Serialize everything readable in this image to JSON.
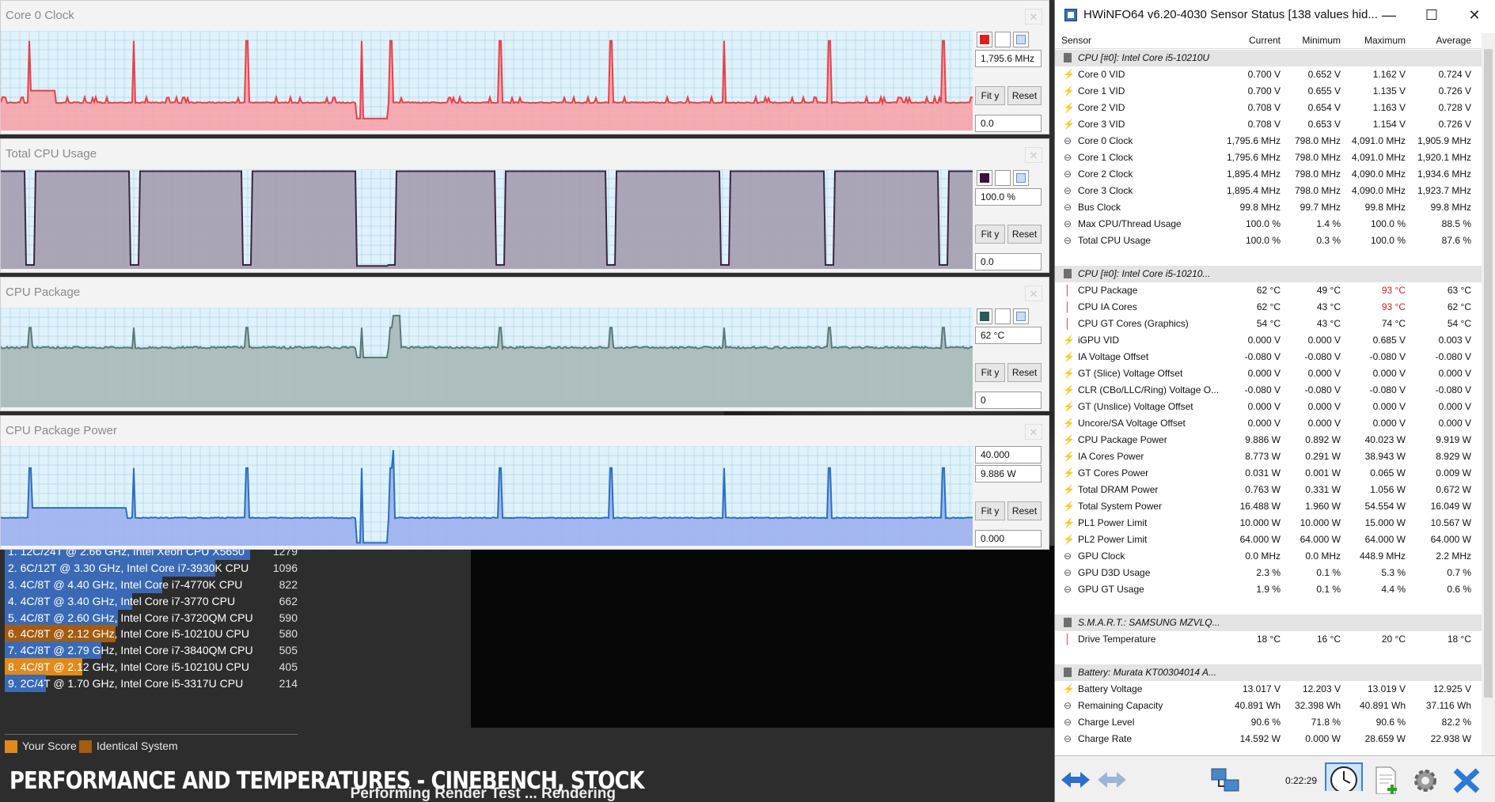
{
  "cinebench": {
    "ranking": [
      {
        "label": "1. 12C/24T @ 2.66 GHz, Intel Xeon CPU X5650",
        "score": "1279",
        "color": "#3a6ab5",
        "fraction": 1.0
      },
      {
        "label": "2. 6C/12T @ 3.30 GHz,  Intel Core i7-3930K CPU",
        "score": "1096",
        "color": "#3a6ab5",
        "fraction": 0.857
      },
      {
        "label": "3. 4C/8T @ 4.40 GHz, Intel Core i7-4770K CPU",
        "score": "822",
        "color": "#3a6ab5",
        "fraction": 0.643
      },
      {
        "label": "4. 4C/8T @ 3.40 GHz,  Intel Core i7-3770 CPU",
        "score": "662",
        "color": "#3a6ab5",
        "fraction": 0.518
      },
      {
        "label": "5. 4C/8T @ 2.60 GHz, Intel Core i7-3720QM CPU",
        "score": "590",
        "color": "#3a6ab5",
        "fraction": 0.461
      },
      {
        "label": "6. 4C/8T @ 2.12 GHz, Intel Core i5-10210U CPU",
        "score": "580",
        "color": "#a35c12",
        "fraction": 0.453
      },
      {
        "label": "7. 4C/8T @ 2.79 GHz, Intel Core i7-3840QM CPU",
        "score": "505",
        "color": "#3a6ab5",
        "fraction": 0.395
      },
      {
        "label": "8. 4C/8T @ 2.12 GHz, Intel Core i5-10210U CPU",
        "score": "405",
        "color": "#e08a1e",
        "fraction": 0.317
      },
      {
        "label": "9. 2C/4T @ 1.70 GHz,  Intel Core i5-3317U CPU",
        "score": "214",
        "color": "#3a6ab5",
        "fraction": 0.167
      }
    ],
    "legend": {
      "your_score": "Your Score",
      "identical_system": "Identical System",
      "your_color": "#e08a1e",
      "identical_color": "#a35c12"
    },
    "status": "Performing Render Test ... Rendering",
    "caption": "PERFORMANCE AND TEMPERATURES - CINEBENCH, STOCK"
  },
  "graphs": [
    {
      "title": "Core 0 Clock",
      "current": "1,795.6 MHz",
      "bottom": "0.0",
      "line_color": "#e8404a",
      "fill_color": "#f6a3a8",
      "swatch": "#e02020",
      "fit": "Fit y",
      "reset": "Reset"
    },
    {
      "title": "Total CPU Usage",
      "current": "100.0 %",
      "bottom": "0.0",
      "line_color": "#3d2440",
      "fill_color": "#a49db0",
      "swatch": "#3d1040",
      "fit": "Fit y",
      "reset": "Reset"
    },
    {
      "title": "CPU Package",
      "current": "62 °C",
      "bottom": "0",
      "line_color": "#5a7a78",
      "fill_color": "#a8b8b8",
      "swatch": "#2a5a5a",
      "fit": "Fit y",
      "reset": "Reset"
    },
    {
      "title": "CPU Package Power",
      "top": "40.000",
      "current": "9.886 W",
      "bottom": "0.000",
      "line_color": "#2a6fc2",
      "fill_color": "#9db0ee",
      "swatch": "#2a6fc2",
      "fit": "Fit y",
      "reset": "Reset"
    }
  ],
  "hwinfo": {
    "title": "HWiNFO64 v6.20-4030 Sensor Status [138 values hid...",
    "columns": {
      "sensor": "Sensor",
      "current": "Current",
      "minimum": "Minimum",
      "maximum": "Maximum",
      "average": "Average"
    },
    "rows": [
      {
        "type": "group",
        "label": "CPU [#0]: Intel Core i5-10210U"
      },
      {
        "type": "volt",
        "label": "Core 0 VID",
        "cur": "0.700 V",
        "min": "0.652 V",
        "max": "1.162 V",
        "avg": "0.724 V"
      },
      {
        "type": "volt",
        "label": "Core 1 VID",
        "cur": "0.700 V",
        "min": "0.655 V",
        "max": "1.135 V",
        "avg": "0.726 V"
      },
      {
        "type": "volt",
        "label": "Core 2 VID",
        "cur": "0.708 V",
        "min": "0.654 V",
        "max": "1.163 V",
        "avg": "0.728 V"
      },
      {
        "type": "volt",
        "label": "Core 3 VID",
        "cur": "0.708 V",
        "min": "0.653 V",
        "max": "1.154 V",
        "avg": "0.726 V"
      },
      {
        "type": "clock",
        "label": "Core 0 Clock",
        "cur": "1,795.6 MHz",
        "min": "798.0 MHz",
        "max": "4,091.0 MHz",
        "avg": "1,905.9 MHz"
      },
      {
        "type": "clock",
        "label": "Core 1 Clock",
        "cur": "1,795.6 MHz",
        "min": "798.0 MHz",
        "max": "4,091.0 MHz",
        "avg": "1,920.1 MHz"
      },
      {
        "type": "clock",
        "label": "Core 2 Clock",
        "cur": "1,895.4 MHz",
        "min": "798.0 MHz",
        "max": "4,090.0 MHz",
        "avg": "1,934.6 MHz"
      },
      {
        "type": "clock",
        "label": "Core 3 Clock",
        "cur": "1,895.4 MHz",
        "min": "798.0 MHz",
        "max": "4,090.0 MHz",
        "avg": "1,923.7 MHz"
      },
      {
        "type": "clock",
        "label": "Bus Clock",
        "cur": "99.8 MHz",
        "min": "99.7 MHz",
        "max": "99.8 MHz",
        "avg": "99.8 MHz"
      },
      {
        "type": "clock",
        "label": "Max CPU/Thread Usage",
        "cur": "100.0 %",
        "min": "1.4 %",
        "max": "100.0 %",
        "avg": "88.5 %"
      },
      {
        "type": "clock",
        "label": "Total CPU Usage",
        "cur": "100.0 %",
        "min": "0.3 %",
        "max": "100.0 %",
        "avg": "87.6 %"
      },
      {
        "type": "blank"
      },
      {
        "type": "group",
        "label": "CPU [#0]: Intel Core i5-10210..."
      },
      {
        "type": "temp",
        "label": "CPU Package",
        "cur": "62 °C",
        "min": "49 °C",
        "max": "93 °C",
        "avg": "63 °C",
        "hotmax": true
      },
      {
        "type": "temp",
        "label": "CPU IA Cores",
        "cur": "62 °C",
        "min": "43 °C",
        "max": "93 °C",
        "avg": "62 °C",
        "hotmax": true
      },
      {
        "type": "temp",
        "label": "CPU GT Cores (Graphics)",
        "cur": "54 °C",
        "min": "43 °C",
        "max": "74 °C",
        "avg": "54 °C"
      },
      {
        "type": "volt",
        "label": "iGPU VID",
        "cur": "0.000 V",
        "min": "0.000 V",
        "max": "0.685 V",
        "avg": "0.003 V"
      },
      {
        "type": "volt",
        "label": "IA Voltage Offset",
        "cur": "-0.080 V",
        "min": "-0.080 V",
        "max": "-0.080 V",
        "avg": "-0.080 V"
      },
      {
        "type": "volt",
        "label": "GT (Slice) Voltage Offset",
        "cur": "0.000 V",
        "min": "0.000 V",
        "max": "0.000 V",
        "avg": "0.000 V"
      },
      {
        "type": "volt",
        "label": "CLR (CBo/LLC/Ring) Voltage O...",
        "cur": "-0.080 V",
        "min": "-0.080 V",
        "max": "-0.080 V",
        "avg": "-0.080 V"
      },
      {
        "type": "volt",
        "label": "GT (Unslice) Voltage Offset",
        "cur": "0.000 V",
        "min": "0.000 V",
        "max": "0.000 V",
        "avg": "0.000 V"
      },
      {
        "type": "volt",
        "label": "Uncore/SA Voltage Offset",
        "cur": "0.000 V",
        "min": "0.000 V",
        "max": "0.000 V",
        "avg": "0.000 V"
      },
      {
        "type": "power",
        "label": "CPU Package Power",
        "cur": "9.886 W",
        "min": "0.892 W",
        "max": "40.023 W",
        "avg": "9.919 W"
      },
      {
        "type": "power",
        "label": "IA Cores Power",
        "cur": "8.773 W",
        "min": "0.291 W",
        "max": "38.943 W",
        "avg": "8.929 W"
      },
      {
        "type": "power",
        "label": "GT Cores Power",
        "cur": "0.031 W",
        "min": "0.001 W",
        "max": "0.065 W",
        "avg": "0.009 W"
      },
      {
        "type": "power",
        "label": "Total DRAM Power",
        "cur": "0.763 W",
        "min": "0.331 W",
        "max": "1.056 W",
        "avg": "0.672 W"
      },
      {
        "type": "power",
        "label": "Total System Power",
        "cur": "16.488 W",
        "min": "1.960 W",
        "max": "54.554 W",
        "avg": "16.049 W"
      },
      {
        "type": "power",
        "label": "PL1 Power Limit",
        "cur": "10.000 W",
        "min": "10.000 W",
        "max": "15.000 W",
        "avg": "10.567 W"
      },
      {
        "type": "power",
        "label": "PL2 Power Limit",
        "cur": "64.000 W",
        "min": "64.000 W",
        "max": "64.000 W",
        "avg": "64.000 W"
      },
      {
        "type": "clock",
        "label": "GPU Clock",
        "cur": "0.0 MHz",
        "min": "0.0 MHz",
        "max": "448.9 MHz",
        "avg": "2.2 MHz"
      },
      {
        "type": "clock",
        "label": "GPU D3D Usage",
        "cur": "2.3 %",
        "min": "0.1 %",
        "max": "5.3 %",
        "avg": "0.7 %"
      },
      {
        "type": "clock",
        "label": "GPU GT Usage",
        "cur": "1.9 %",
        "min": "0.1 %",
        "max": "4.4 %",
        "avg": "0.6 %"
      },
      {
        "type": "blank"
      },
      {
        "type": "group",
        "label": "S.M.A.R.T.: SAMSUNG MZVLQ..."
      },
      {
        "type": "temp",
        "label": "Drive Temperature",
        "cur": "18 °C",
        "min": "16 °C",
        "max": "20 °C",
        "avg": "18 °C"
      },
      {
        "type": "blank"
      },
      {
        "type": "group",
        "label": "Battery: Murata KT00304014 A..."
      },
      {
        "type": "volt",
        "label": "Battery Voltage",
        "cur": "13.017 V",
        "min": "12.203 V",
        "max": "13.019 V",
        "avg": "12.925 V"
      },
      {
        "type": "clock",
        "label": "Remaining Capacity",
        "cur": "40.891 Wh",
        "min": "32.398 Wh",
        "max": "40.891 Wh",
        "avg": "37.116 Wh"
      },
      {
        "type": "clock",
        "label": "Charge Level",
        "cur": "90.6 %",
        "min": "71.8 %",
        "max": "90.6 %",
        "avg": "82.2 %"
      },
      {
        "type": "clock",
        "label": "Charge Rate",
        "cur": "14.592 W",
        "min": "0.000 W",
        "max": "28.659 W",
        "avg": "22.938 W"
      }
    ],
    "elapsed": "0:22:29"
  }
}
